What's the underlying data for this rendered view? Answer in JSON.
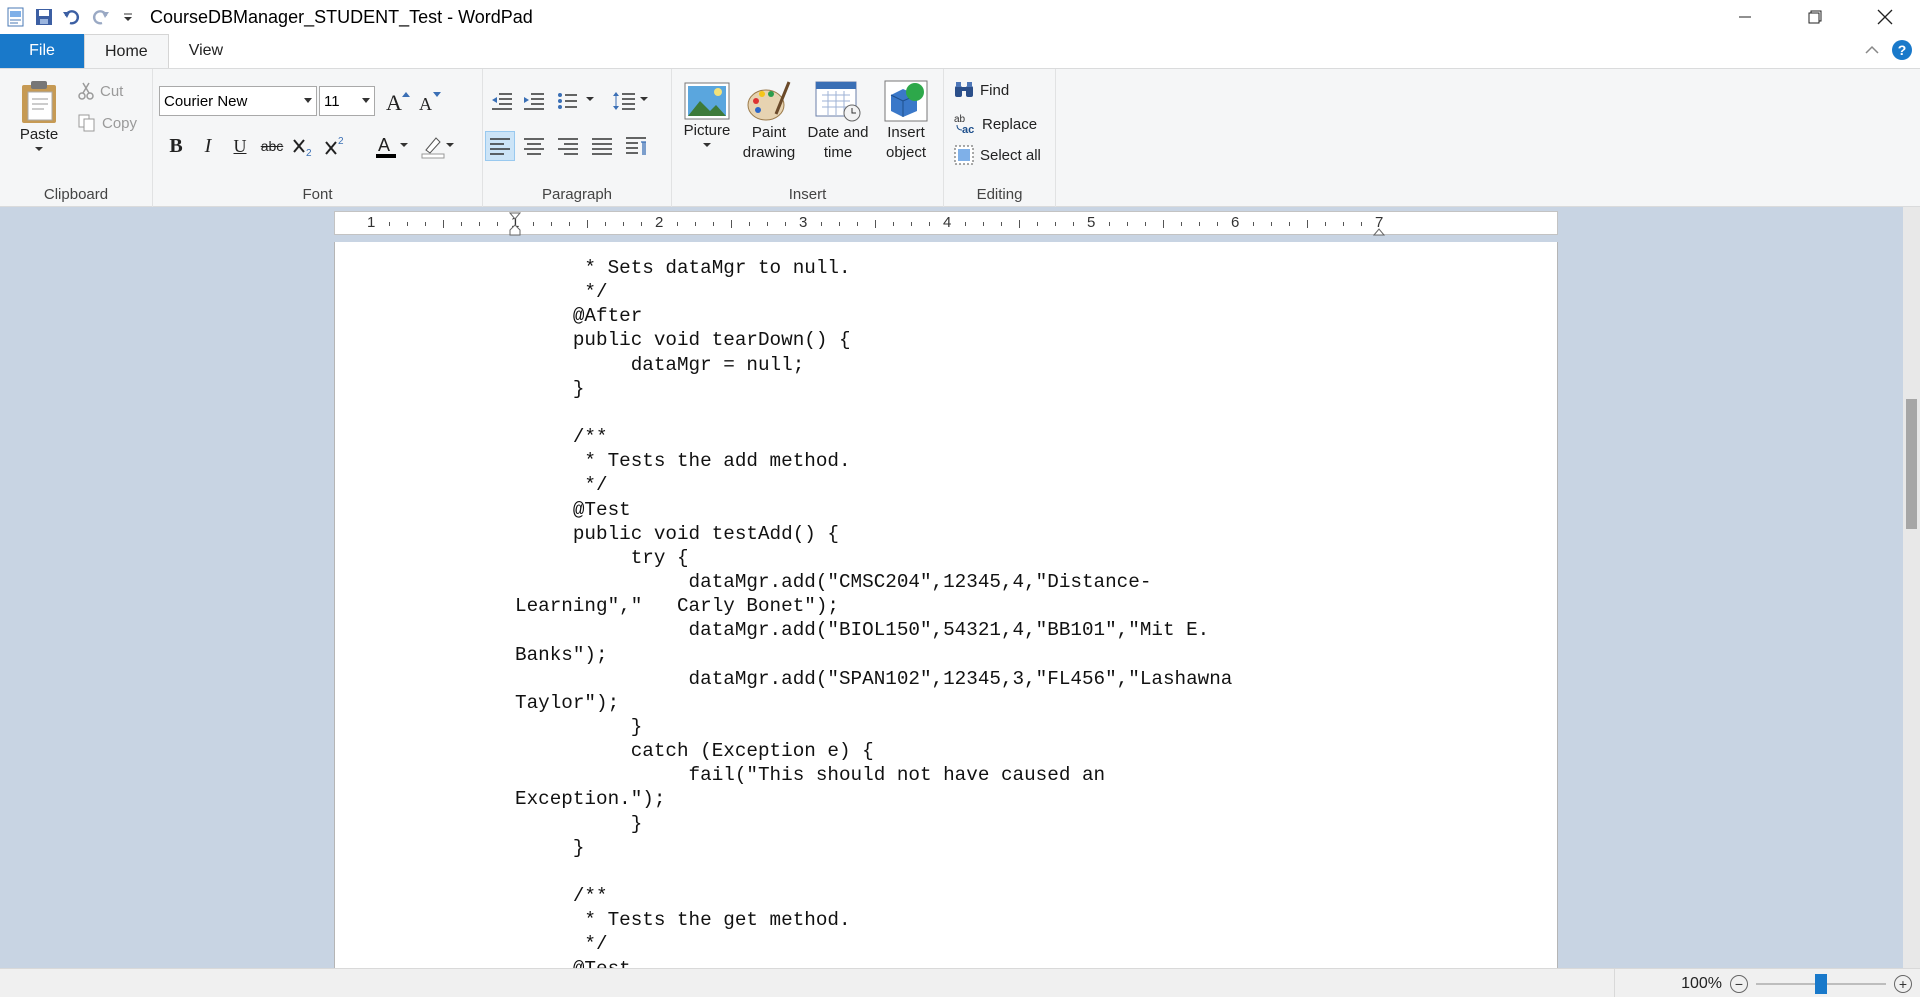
{
  "window": {
    "title": "CourseDBManager_STUDENT_Test - WordPad",
    "controls": [
      "minimize-icon",
      "restore-icon",
      "close-icon"
    ]
  },
  "quick_access": {
    "icons": [
      "wordpad-app-icon",
      "save-icon",
      "undo-icon",
      "redo-icon",
      "customize-qat-icon"
    ]
  },
  "tabs": {
    "file": "File",
    "home": "Home",
    "view": "View",
    "help": "?"
  },
  "ribbon": {
    "clipboard": {
      "group_label": "Clipboard",
      "paste": "Paste",
      "cut": "Cut",
      "copy": "Copy"
    },
    "font": {
      "group_label": "Font",
      "family": "Courier New",
      "size": "11",
      "bold": "B",
      "italic": "I",
      "underline": "U",
      "strike": "abc"
    },
    "paragraph": {
      "group_label": "Paragraph"
    },
    "insert": {
      "group_label": "Insert",
      "picture": "Picture",
      "paint_line1": "Paint",
      "paint_line2": "drawing",
      "datetime_line1": "Date and",
      "datetime_line2": "time",
      "object_line1": "Insert",
      "object_line2": "object"
    },
    "editing": {
      "group_label": "Editing",
      "find": "Find",
      "replace": "Replace",
      "select_all": "Select all"
    }
  },
  "ruler": {
    "labels": [
      "1",
      "1",
      "2",
      "3",
      "4",
      "5",
      "6",
      "7"
    ]
  },
  "document": {
    "lines": [
      "\t * Sets dataMgr to null.",
      "\t */",
      "\t@After",
      "\tpublic void tearDown() {",
      "\t\tdataMgr = null;",
      "\t}",
      "",
      "\t/**",
      "\t * Tests the add method.",
      "\t */",
      "\t@Test",
      "\tpublic void testAdd() {",
      "\t\ttry {",
      "\t\t\tdataMgr.add(\"CMSC204\",12345,4,\"Distance-",
      "Learning\",\"   Carly Bonet\");",
      "\t\t\tdataMgr.add(\"BIOL150\",54321,4,\"BB101\",\"Mit E.",
      "Banks\");",
      "\t\t\tdataMgr.add(\"SPAN102\",12345,3,\"FL456\",\"Lashawna",
      "Taylor\");",
      "\t\t}",
      "\t\tcatch (Exception e) {",
      "\t\t\tfail(\"This should not have caused an",
      "Exception.\");",
      "\t\t}",
      "\t}",
      "",
      "\t/**",
      "\t * Tests the get method.",
      "\t */",
      "\t@Test"
    ]
  },
  "status": {
    "zoom": "100%",
    "zoom_level": 0.5
  },
  "colors": {
    "accent": "#1979ca",
    "doc_background": "#c8d4e3",
    "ribbon_background": "#f5f6f7"
  }
}
